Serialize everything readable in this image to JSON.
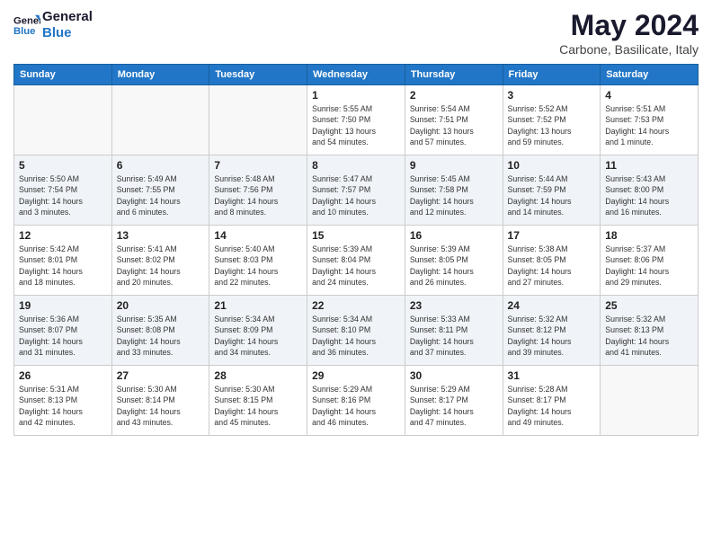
{
  "header": {
    "logo_line1": "General",
    "logo_line2": "Blue",
    "month_year": "May 2024",
    "location": "Carbone, Basilicate, Italy"
  },
  "days_of_week": [
    "Sunday",
    "Monday",
    "Tuesday",
    "Wednesday",
    "Thursday",
    "Friday",
    "Saturday"
  ],
  "weeks": [
    [
      {
        "day": "",
        "info": ""
      },
      {
        "day": "",
        "info": ""
      },
      {
        "day": "",
        "info": ""
      },
      {
        "day": "1",
        "info": "Sunrise: 5:55 AM\nSunset: 7:50 PM\nDaylight: 13 hours\nand 54 minutes."
      },
      {
        "day": "2",
        "info": "Sunrise: 5:54 AM\nSunset: 7:51 PM\nDaylight: 13 hours\nand 57 minutes."
      },
      {
        "day": "3",
        "info": "Sunrise: 5:52 AM\nSunset: 7:52 PM\nDaylight: 13 hours\nand 59 minutes."
      },
      {
        "day": "4",
        "info": "Sunrise: 5:51 AM\nSunset: 7:53 PM\nDaylight: 14 hours\nand 1 minute."
      }
    ],
    [
      {
        "day": "5",
        "info": "Sunrise: 5:50 AM\nSunset: 7:54 PM\nDaylight: 14 hours\nand 3 minutes."
      },
      {
        "day": "6",
        "info": "Sunrise: 5:49 AM\nSunset: 7:55 PM\nDaylight: 14 hours\nand 6 minutes."
      },
      {
        "day": "7",
        "info": "Sunrise: 5:48 AM\nSunset: 7:56 PM\nDaylight: 14 hours\nand 8 minutes."
      },
      {
        "day": "8",
        "info": "Sunrise: 5:47 AM\nSunset: 7:57 PM\nDaylight: 14 hours\nand 10 minutes."
      },
      {
        "day": "9",
        "info": "Sunrise: 5:45 AM\nSunset: 7:58 PM\nDaylight: 14 hours\nand 12 minutes."
      },
      {
        "day": "10",
        "info": "Sunrise: 5:44 AM\nSunset: 7:59 PM\nDaylight: 14 hours\nand 14 minutes."
      },
      {
        "day": "11",
        "info": "Sunrise: 5:43 AM\nSunset: 8:00 PM\nDaylight: 14 hours\nand 16 minutes."
      }
    ],
    [
      {
        "day": "12",
        "info": "Sunrise: 5:42 AM\nSunset: 8:01 PM\nDaylight: 14 hours\nand 18 minutes."
      },
      {
        "day": "13",
        "info": "Sunrise: 5:41 AM\nSunset: 8:02 PM\nDaylight: 14 hours\nand 20 minutes."
      },
      {
        "day": "14",
        "info": "Sunrise: 5:40 AM\nSunset: 8:03 PM\nDaylight: 14 hours\nand 22 minutes."
      },
      {
        "day": "15",
        "info": "Sunrise: 5:39 AM\nSunset: 8:04 PM\nDaylight: 14 hours\nand 24 minutes."
      },
      {
        "day": "16",
        "info": "Sunrise: 5:39 AM\nSunset: 8:05 PM\nDaylight: 14 hours\nand 26 minutes."
      },
      {
        "day": "17",
        "info": "Sunrise: 5:38 AM\nSunset: 8:05 PM\nDaylight: 14 hours\nand 27 minutes."
      },
      {
        "day": "18",
        "info": "Sunrise: 5:37 AM\nSunset: 8:06 PM\nDaylight: 14 hours\nand 29 minutes."
      }
    ],
    [
      {
        "day": "19",
        "info": "Sunrise: 5:36 AM\nSunset: 8:07 PM\nDaylight: 14 hours\nand 31 minutes."
      },
      {
        "day": "20",
        "info": "Sunrise: 5:35 AM\nSunset: 8:08 PM\nDaylight: 14 hours\nand 33 minutes."
      },
      {
        "day": "21",
        "info": "Sunrise: 5:34 AM\nSunset: 8:09 PM\nDaylight: 14 hours\nand 34 minutes."
      },
      {
        "day": "22",
        "info": "Sunrise: 5:34 AM\nSunset: 8:10 PM\nDaylight: 14 hours\nand 36 minutes."
      },
      {
        "day": "23",
        "info": "Sunrise: 5:33 AM\nSunset: 8:11 PM\nDaylight: 14 hours\nand 37 minutes."
      },
      {
        "day": "24",
        "info": "Sunrise: 5:32 AM\nSunset: 8:12 PM\nDaylight: 14 hours\nand 39 minutes."
      },
      {
        "day": "25",
        "info": "Sunrise: 5:32 AM\nSunset: 8:13 PM\nDaylight: 14 hours\nand 41 minutes."
      }
    ],
    [
      {
        "day": "26",
        "info": "Sunrise: 5:31 AM\nSunset: 8:13 PM\nDaylight: 14 hours\nand 42 minutes."
      },
      {
        "day": "27",
        "info": "Sunrise: 5:30 AM\nSunset: 8:14 PM\nDaylight: 14 hours\nand 43 minutes."
      },
      {
        "day": "28",
        "info": "Sunrise: 5:30 AM\nSunset: 8:15 PM\nDaylight: 14 hours\nand 45 minutes."
      },
      {
        "day": "29",
        "info": "Sunrise: 5:29 AM\nSunset: 8:16 PM\nDaylight: 14 hours\nand 46 minutes."
      },
      {
        "day": "30",
        "info": "Sunrise: 5:29 AM\nSunset: 8:17 PM\nDaylight: 14 hours\nand 47 minutes."
      },
      {
        "day": "31",
        "info": "Sunrise: 5:28 AM\nSunset: 8:17 PM\nDaylight: 14 hours\nand 49 minutes."
      },
      {
        "day": "",
        "info": ""
      }
    ]
  ]
}
